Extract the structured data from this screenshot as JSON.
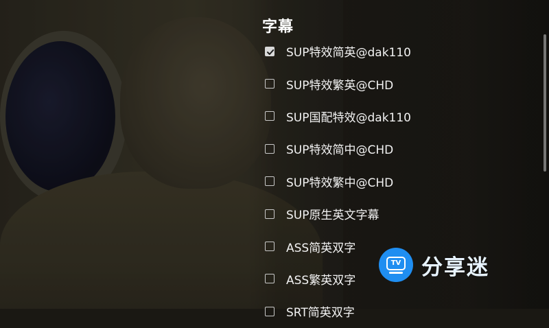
{
  "panel": {
    "title": "字幕"
  },
  "subtitle_options": [
    {
      "label": "SUP特效简英@dak110",
      "checked": true
    },
    {
      "label": "SUP特效繁英@CHD",
      "checked": false
    },
    {
      "label": "SUP国配特效@dak110",
      "checked": false
    },
    {
      "label": "SUP特效简中@CHD",
      "checked": false
    },
    {
      "label": "SUP特效繁中@CHD",
      "checked": false
    },
    {
      "label": "SUP原生英文字幕",
      "checked": false
    },
    {
      "label": "ASS简英双字",
      "checked": false
    },
    {
      "label": "ASS繁英双字",
      "checked": false
    },
    {
      "label": "SRT简英双字",
      "checked": false
    }
  ],
  "watermark": {
    "badge_text": "TV",
    "brand_text": "分享迷",
    "brand_color": "#1f8ef1"
  },
  "icons": {
    "checked": "checkbox-checked-icon",
    "unchecked": "checkbox-unchecked-icon",
    "logo": "tv-logo-icon"
  }
}
